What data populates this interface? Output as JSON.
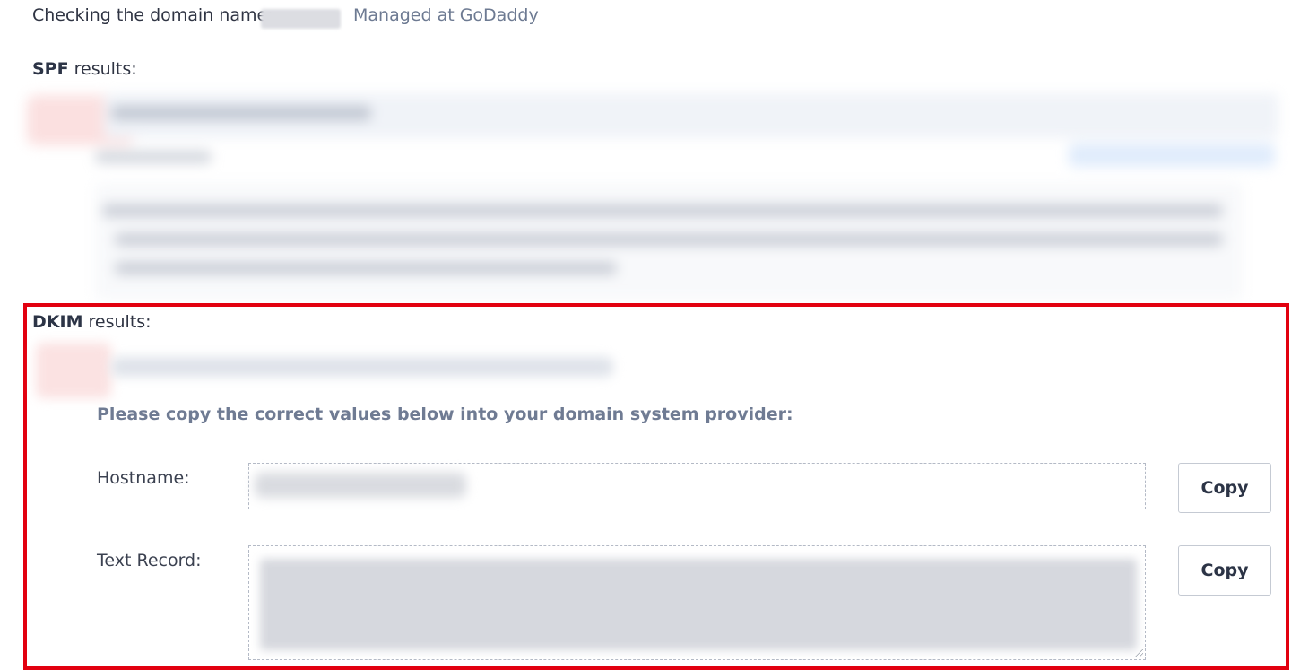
{
  "header": {
    "checking_label": "Checking the domain name:",
    "managed_text": "Managed at GoDaddy"
  },
  "spf": {
    "heading_bold": "SPF",
    "heading_rest": " results:"
  },
  "dkim": {
    "heading_bold": "DKIM",
    "heading_rest": " results:",
    "instruction": "Please copy the correct values below into your domain system provider:",
    "hostname_label": "Hostname:",
    "textrecord_label": "Text Record:",
    "copy_label": "Copy"
  },
  "colors": {
    "highlight_border": "#e2000f",
    "muted_text": "#6d7a92",
    "heading_text": "#2c3446"
  }
}
